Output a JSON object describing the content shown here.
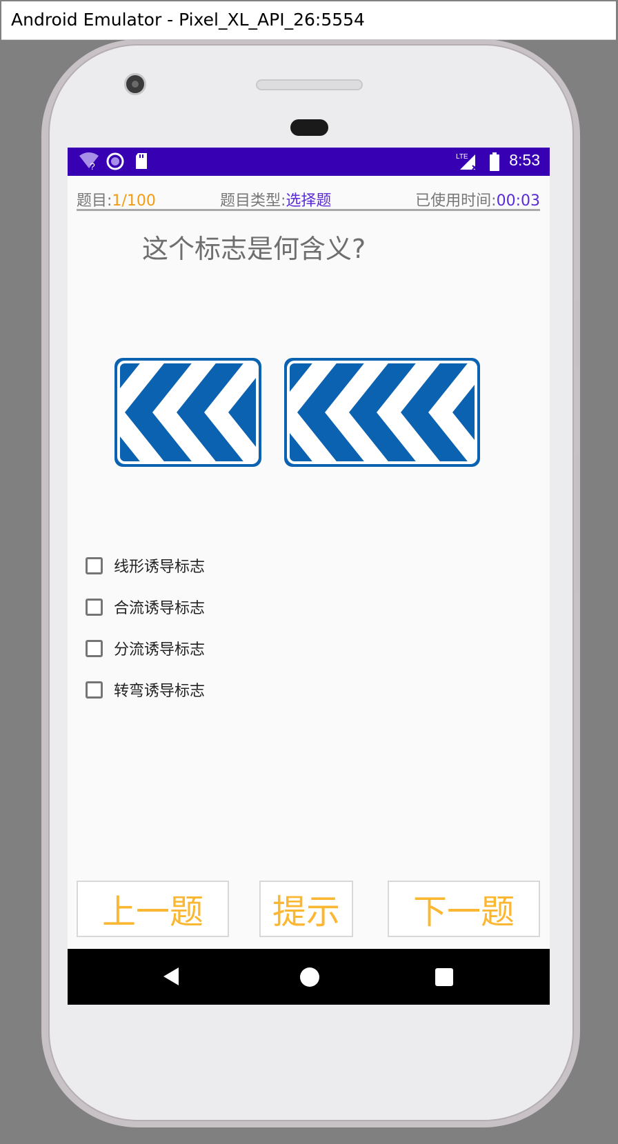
{
  "window": {
    "title": "Android Emulator - Pixel_XL_API_26:5554"
  },
  "status_bar": {
    "time": "8:53",
    "icons": [
      "wifi-unknown-icon",
      "sync-circle-icon",
      "sd-card-icon",
      "lte-signal-icon",
      "battery-icon"
    ],
    "lte_label": "LTE"
  },
  "info": {
    "question_label": "题目:",
    "question_progress": "1/100",
    "type_label": "题目类型:",
    "type_value": "选择题",
    "time_label": "已使用时间:",
    "time_value": "00:03"
  },
  "question": {
    "text": "这个标志是何含义?"
  },
  "sign": {
    "color": "#0a62b0",
    "icon": "chevron-left-sign-icon"
  },
  "options": [
    {
      "label": "线形诱导标志",
      "checked": false
    },
    {
      "label": "合流诱导标志",
      "checked": false
    },
    {
      "label": "分流诱导标志",
      "checked": false
    },
    {
      "label": "转弯诱导标志",
      "checked": false
    }
  ],
  "buttons": {
    "prev": "上一题",
    "hint": "提示",
    "next": "下一题"
  },
  "colors": {
    "status_bar": "#3700b3",
    "accent_orange": "#f39c12",
    "accent_purple": "#5a2bd6",
    "button_text": "#fbb731"
  }
}
